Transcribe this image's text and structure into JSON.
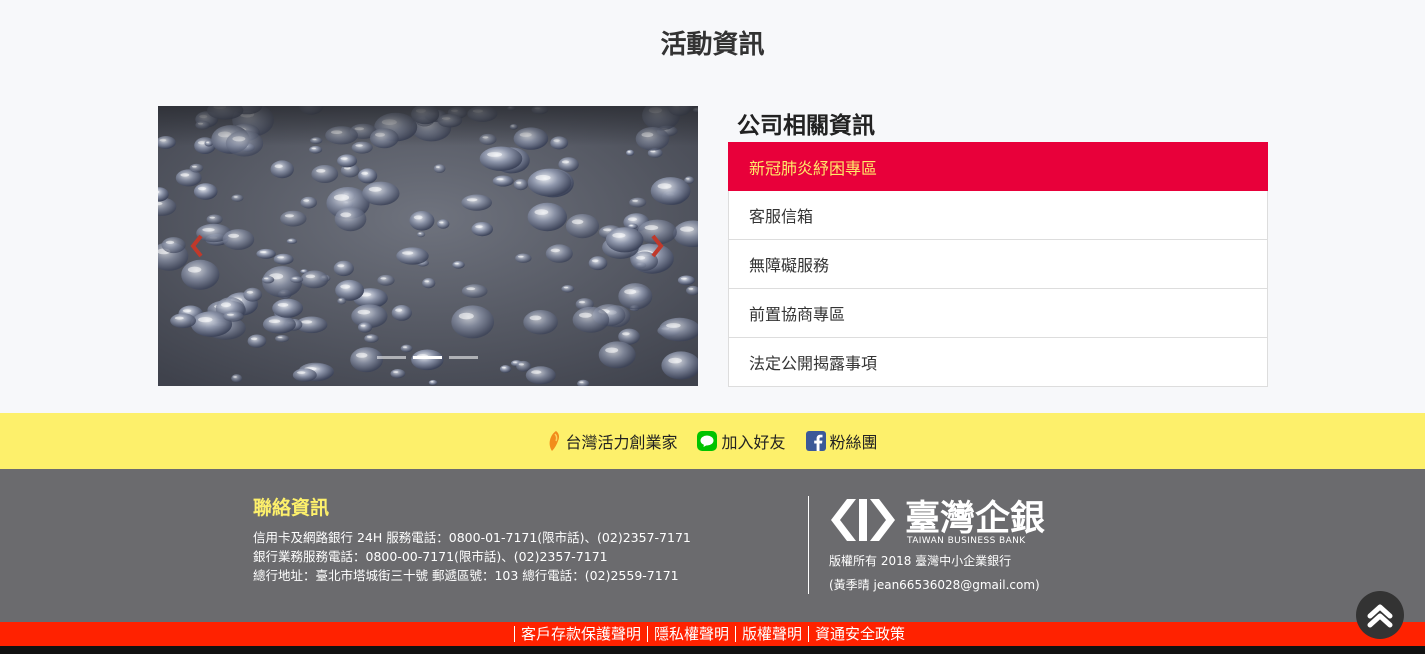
{
  "page": {
    "section_title": "活動資訊"
  },
  "carousel": {
    "slide_count": 3,
    "active_index": 1
  },
  "info": {
    "title": "公司相關資訊",
    "items": [
      {
        "label": "新冠肺炎紓困專區",
        "active": true
      },
      {
        "label": "客服信箱"
      },
      {
        "label": "無障礙服務"
      },
      {
        "label": "前置協商專區"
      },
      {
        "label": "法定公開揭露事項"
      }
    ]
  },
  "social": {
    "links": [
      {
        "label": "台灣活力創業家",
        "icon": "taiwan-icon"
      },
      {
        "label": "加入好友",
        "icon": "line-icon"
      },
      {
        "label": "粉絲團",
        "icon": "facebook-icon"
      }
    ]
  },
  "footer": {
    "contact_title": "聯絡資訊",
    "contact_lines": [
      "信用卡及網路銀行 24H 服務電話：0800-01-7171(限市話)、(02)2357-7171",
      "銀行業務服務電話：0800-00-7171(限市話)、(02)2357-7171",
      "總行地址：臺北市塔城街三十號 郵遞區號：103 總行電話：(02)2559-7171"
    ],
    "logo_cn": "臺灣企銀",
    "logo_en": "TAIWAN BUSINESS BANK",
    "copyright": "版權所有 2018 臺灣中小企業銀行",
    "author": "(黃季晴 jean66536028@gmail.com)"
  },
  "policy": {
    "links": [
      "客戶存款保護聲明",
      "隱私權聲明",
      "版權聲明",
      "資通安全政策"
    ]
  },
  "colors": {
    "accent_red": "#e8003a",
    "accent_yellow": "#fdf06b",
    "footer_gray": "#6b6b6e",
    "policy_red": "#ff2200"
  }
}
